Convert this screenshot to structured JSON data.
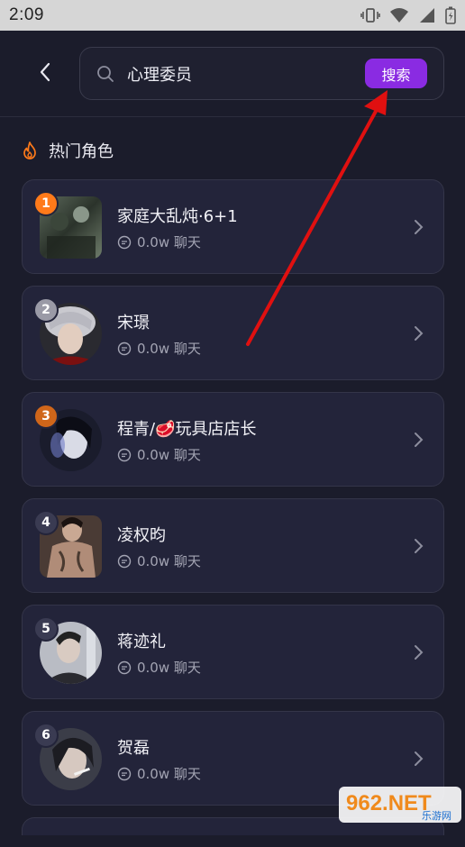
{
  "status_bar": {
    "time": "2:09"
  },
  "search": {
    "value": "心理委员",
    "button_label": "搜索"
  },
  "section": {
    "title": "热门角色"
  },
  "characters": [
    {
      "rank": "1",
      "name": "家庭大乱炖·6+1",
      "stats": "0.0w 聊天",
      "rank_color": "#ff7a1a"
    },
    {
      "rank": "2",
      "name": "宋璟",
      "stats": "0.0w 聊天",
      "rank_color": "#9a9aa6"
    },
    {
      "rank": "3",
      "name": "程青/🥩玩具店店长",
      "stats": "0.0w 聊天",
      "rank_color": "#d0661a"
    },
    {
      "rank": "4",
      "name": "凌权昀",
      "stats": "0.0w 聊天",
      "rank_color": "#3a3b52"
    },
    {
      "rank": "5",
      "name": "蒋迹礼",
      "stats": "0.0w 聊天",
      "rank_color": "#3a3b52"
    },
    {
      "rank": "6",
      "name": "贺磊",
      "stats": "0.0w 聊天",
      "rank_color": "#3a3b52"
    }
  ],
  "watermark": {
    "text": "962.NET",
    "subtext": "乐游网"
  },
  "colors": {
    "accent": "#8a2be2",
    "annotation_arrow": "#e01010",
    "flame": "#ff7a1a"
  }
}
